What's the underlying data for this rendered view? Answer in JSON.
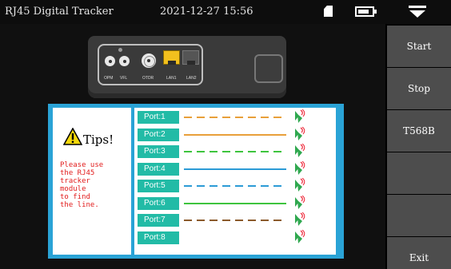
{
  "status_bar": {
    "title": "RJ45 Digital Tracker",
    "datetime": "2021-12-27 15:56",
    "battery_level": 0.8
  },
  "device": {
    "port_labels": [
      "OPM",
      "VFL",
      "OTDR",
      "LAN1",
      "LAN2"
    ],
    "active_port": "LAN1"
  },
  "tips": {
    "title": "Tips!",
    "message": "Please use\nthe RJ45\ntracker\nmodule\nto find\nthe line."
  },
  "ports": [
    {
      "label": "Port:1",
      "color": "#e8a03a",
      "stripe": "#ffffff",
      "style": "dashed"
    },
    {
      "label": "Port:2",
      "color": "#e8a03a",
      "stripe": "",
      "style": "solid"
    },
    {
      "label": "Port:3",
      "color": "#3ec43e",
      "stripe": "#ffffff",
      "style": "dashed"
    },
    {
      "label": "Port:4",
      "color": "#2c9bd6",
      "stripe": "",
      "style": "solid"
    },
    {
      "label": "Port:5",
      "color": "#2c9bd6",
      "stripe": "#ffffff",
      "style": "dashed"
    },
    {
      "label": "Port:6",
      "color": "#3ec43e",
      "stripe": "",
      "style": "solid"
    },
    {
      "label": "Port:7",
      "color": "#8b5a2b",
      "stripe": "#ffffff",
      "style": "dashed"
    },
    {
      "label": "Port:8",
      "color": "",
      "stripe": "",
      "style": "none"
    }
  ],
  "menu": {
    "start": "Start",
    "stop": "Stop",
    "standard": "T568B",
    "empty_1": "",
    "empty_2": "",
    "exit": "Exit"
  },
  "colors": {
    "accent": "#2aa3d6",
    "port_label_bg": "#22bba6",
    "warning_text": "#e21c1c",
    "menu_button": "#4d4d4d"
  }
}
